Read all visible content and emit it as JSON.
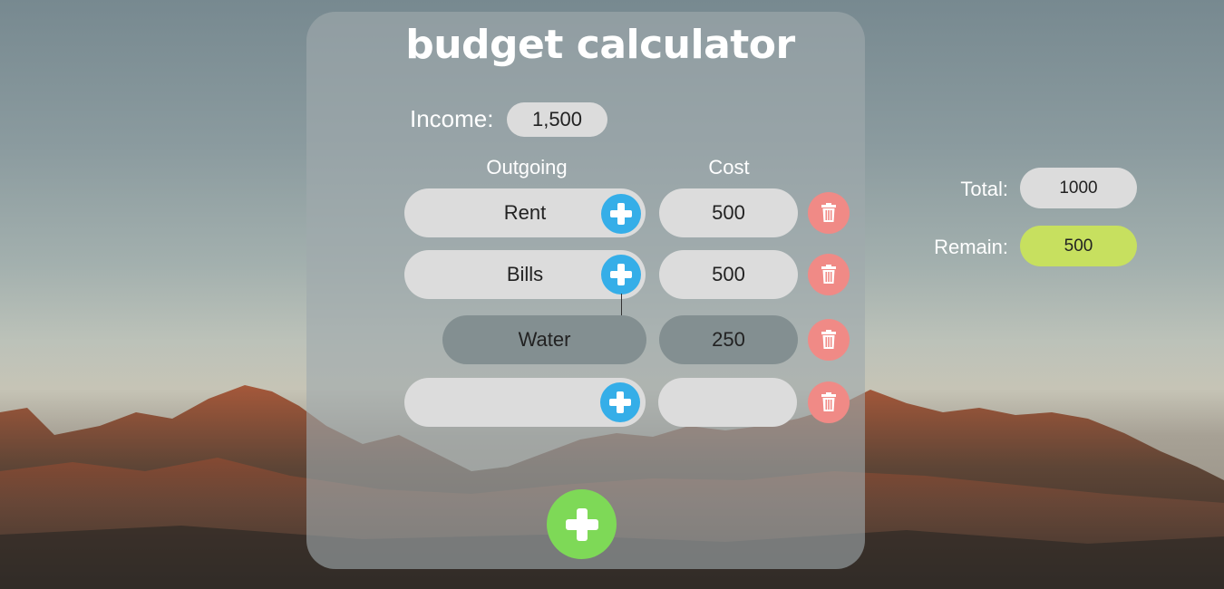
{
  "app": {
    "title": "budget calculator"
  },
  "income": {
    "label": "Income:",
    "value": "1,500"
  },
  "columns": {
    "outgoing": "Outgoing",
    "cost": "Cost"
  },
  "rows": [
    {
      "name": "Rent",
      "cost": "500",
      "style": "normal"
    },
    {
      "name": "Bills",
      "cost": "500",
      "style": "normal"
    },
    {
      "name": "Water",
      "cost": "250",
      "style": "sub-item"
    },
    {
      "name": "",
      "cost": "",
      "style": "empty"
    }
  ],
  "summary": {
    "total_label": "Total:",
    "total_value": "1000",
    "remain_label": "Remain:",
    "remain_value": "500"
  },
  "icons": {
    "add_sub_item": "plus-icon",
    "delete_row": "trash-icon",
    "add_row": "plus-icon"
  },
  "colors": {
    "plus_button": "#35aee8",
    "trash_button": "#f08a86",
    "add_row_button": "#7ed957",
    "remain_highlight": "#c7e05f",
    "field": "#dcdcdc",
    "sub_item_field": "#838f91"
  }
}
